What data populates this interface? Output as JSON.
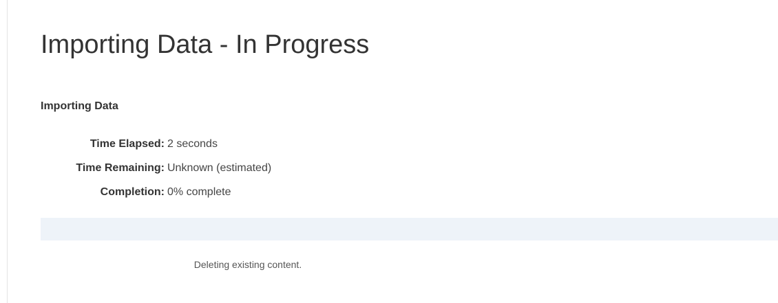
{
  "page": {
    "title": "Importing Data - In Progress"
  },
  "import": {
    "heading": "Importing Data",
    "stats": [
      {
        "label": "Time Elapsed:",
        "value": "2 seconds"
      },
      {
        "label": "Time Remaining:",
        "value": "Unknown (estimated)"
      },
      {
        "label": "Completion:",
        "value": "0% complete"
      }
    ],
    "progress_percent": 0,
    "message": "Deleting existing content."
  },
  "colors": {
    "progress_track": "#eef3f9",
    "progress_fill": "#337ab7"
  }
}
